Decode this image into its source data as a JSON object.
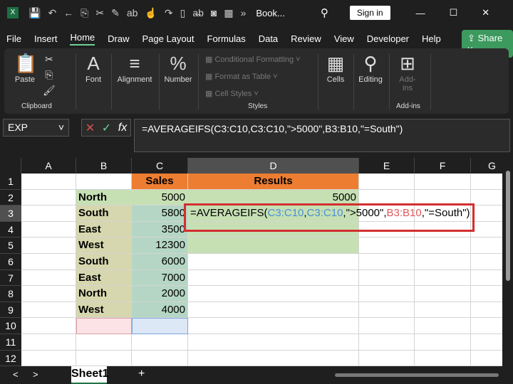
{
  "titlebar": {
    "title": "Book...",
    "sign_in": "Sign in",
    "overflow": "»"
  },
  "menu_tabs": [
    "File",
    "Insert",
    "Home",
    "Draw",
    "Page Layout",
    "Formulas",
    "Data",
    "Review",
    "View",
    "Developer",
    "Help"
  ],
  "active_tab": "Home",
  "share_label": "Share",
  "ribbon": {
    "paste": "Paste",
    "clipboard": "Clipboard",
    "font": "Font",
    "alignment": "Alignment",
    "number": "Number",
    "conditional_formatting": "Conditional Formatting",
    "format_as_table": "Format as Table",
    "cell_styles": "Cell Styles",
    "styles": "Styles",
    "cells": "Cells",
    "editing": "Editing",
    "addins_button": "Add-ins",
    "addins_group": "Add-ins"
  },
  "formula_bar": {
    "name_box": "EXP",
    "formula": "=AVERAGEIFS(C3:C10,C3:C10,\">5000\",B3:B10,\"=South\")"
  },
  "columns": [
    "A",
    "B",
    "C",
    "D",
    "E",
    "F",
    "G"
  ],
  "rows": [
    "1",
    "2",
    "3",
    "4",
    "5",
    "6",
    "7",
    "8",
    "9",
    "10",
    "11",
    "12"
  ],
  "cells": {
    "C1": "Sales",
    "D1": "Results",
    "B": [
      "North",
      "South",
      "East",
      "West",
      "South",
      "East",
      "North",
      "West"
    ],
    "C": [
      "5000",
      "5800",
      "3500",
      "12300",
      "6000",
      "7000",
      "2000",
      "4000"
    ],
    "D2": "5000",
    "D3_parts": [
      "=AVERAGEIFS(",
      "C3:C10",
      ",",
      "C3:C10",
      ",\">5000\",",
      "B3:B10",
      ",\"=South\")"
    ]
  },
  "colors": {
    "header_orange": "#ed7d31",
    "green_fill": "#c6e0b4",
    "ref_blue": "#4a8fd6",
    "ref_red": "#e0575b",
    "highlight_box": "#d32f2f"
  },
  "sheet_tab": "Sheet1"
}
